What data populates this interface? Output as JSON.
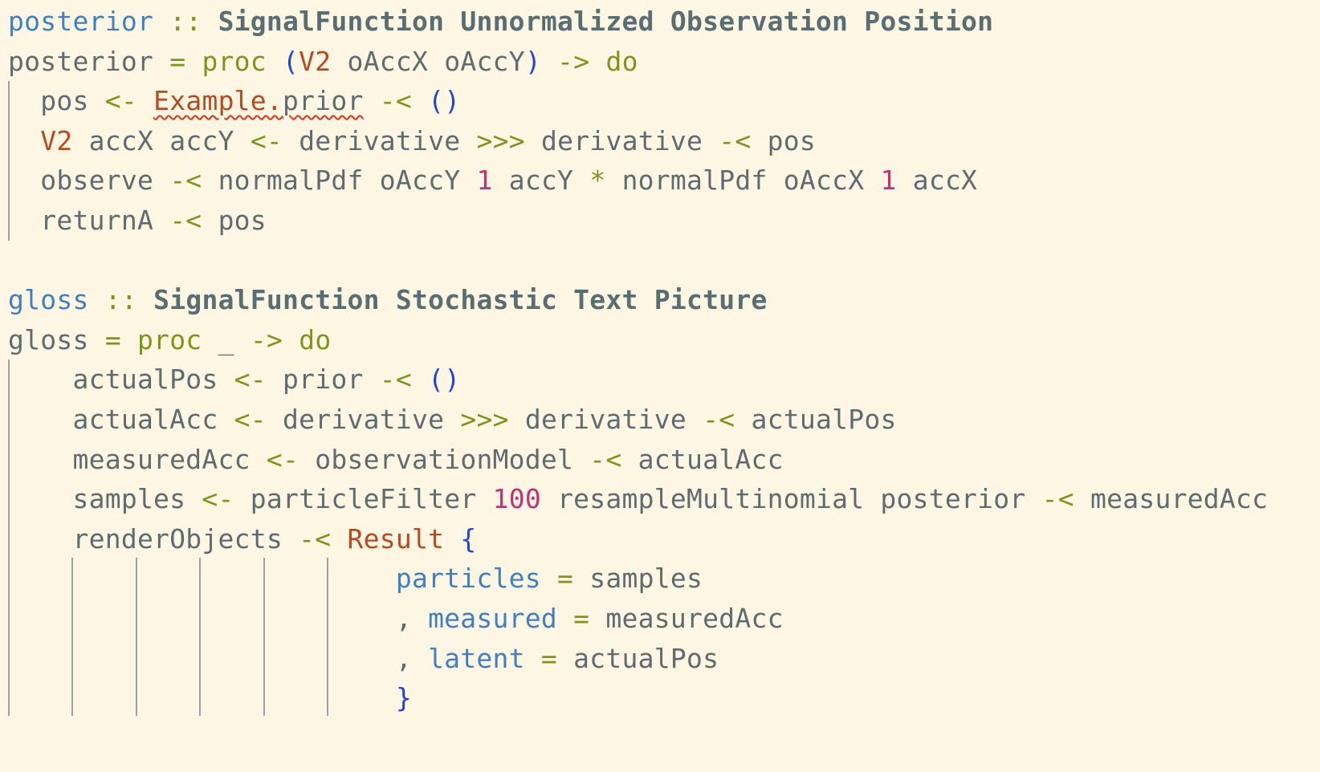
{
  "editor": {
    "language": "haskell",
    "theme": "solarized-light",
    "lines": [
      {
        "tokens": [
          {
            "t": "posterior",
            "c": "fn"
          },
          {
            "t": " "
          },
          {
            "t": "::",
            "c": "op"
          },
          {
            "t": " "
          },
          {
            "t": "SignalFunction Unnormalized Observation Position",
            "c": "ty"
          }
        ]
      },
      {
        "tokens": [
          {
            "t": "posterior",
            "c": "id"
          },
          {
            "t": " "
          },
          {
            "t": "=",
            "c": "op"
          },
          {
            "t": " "
          },
          {
            "t": "proc",
            "c": "kw"
          },
          {
            "t": " "
          },
          {
            "t": "(",
            "c": "par"
          },
          {
            "t": "V2",
            "c": "con"
          },
          {
            "t": " oAccX oAccY",
            "c": "id"
          },
          {
            "t": ")",
            "c": "par"
          },
          {
            "t": " "
          },
          {
            "t": "->",
            "c": "op"
          },
          {
            "t": " "
          },
          {
            "t": "do",
            "c": "kw"
          }
        ]
      },
      {
        "tokens": [
          {
            "t": "  pos",
            "c": "id"
          },
          {
            "t": " "
          },
          {
            "t": "<-",
            "c": "op"
          },
          {
            "t": " "
          },
          {
            "t": "Example.",
            "c": "con",
            "sq": true
          },
          {
            "t": "prior",
            "c": "id",
            "sq": true
          },
          {
            "t": " "
          },
          {
            "t": "-<",
            "c": "op"
          },
          {
            "t": " "
          },
          {
            "t": "()",
            "c": "par"
          }
        ]
      },
      {
        "tokens": [
          {
            "t": "  "
          },
          {
            "t": "V2",
            "c": "con"
          },
          {
            "t": " accX accY",
            "c": "id"
          },
          {
            "t": " "
          },
          {
            "t": "<-",
            "c": "op"
          },
          {
            "t": " "
          },
          {
            "t": "derivative",
            "c": "id"
          },
          {
            "t": " "
          },
          {
            "t": ">>>",
            "c": "op"
          },
          {
            "t": " "
          },
          {
            "t": "derivative",
            "c": "id"
          },
          {
            "t": " "
          },
          {
            "t": "-<",
            "c": "op"
          },
          {
            "t": " "
          },
          {
            "t": "pos",
            "c": "id"
          }
        ]
      },
      {
        "tokens": [
          {
            "t": "  observe",
            "c": "id"
          },
          {
            "t": " "
          },
          {
            "t": "-<",
            "c": "op"
          },
          {
            "t": " "
          },
          {
            "t": "normalPdf oAccY",
            "c": "id"
          },
          {
            "t": " "
          },
          {
            "t": "1",
            "c": "num"
          },
          {
            "t": " "
          },
          {
            "t": "accY",
            "c": "id"
          },
          {
            "t": " "
          },
          {
            "t": "*",
            "c": "op"
          },
          {
            "t": " "
          },
          {
            "t": "normalPdf oAccX",
            "c": "id"
          },
          {
            "t": " "
          },
          {
            "t": "1",
            "c": "num"
          },
          {
            "t": " "
          },
          {
            "t": "accX",
            "c": "id"
          }
        ]
      },
      {
        "tokens": [
          {
            "t": "  returnA",
            "c": "id"
          },
          {
            "t": " "
          },
          {
            "t": "-<",
            "c": "op"
          },
          {
            "t": " "
          },
          {
            "t": "pos",
            "c": "id"
          }
        ]
      },
      {
        "tokens": []
      },
      {
        "tokens": [
          {
            "t": "gloss",
            "c": "fn"
          },
          {
            "t": " "
          },
          {
            "t": "::",
            "c": "op"
          },
          {
            "t": " "
          },
          {
            "t": "SignalFunction Stochastic Text Picture",
            "c": "ty"
          }
        ]
      },
      {
        "tokens": [
          {
            "t": "gloss",
            "c": "id"
          },
          {
            "t": " "
          },
          {
            "t": "=",
            "c": "op"
          },
          {
            "t": " "
          },
          {
            "t": "proc",
            "c": "kw"
          },
          {
            "t": " "
          },
          {
            "t": "_",
            "c": "id"
          },
          {
            "t": " "
          },
          {
            "t": "->",
            "c": "op"
          },
          {
            "t": " "
          },
          {
            "t": "do",
            "c": "kw"
          }
        ]
      },
      {
        "tokens": [
          {
            "t": "    actualPos",
            "c": "id"
          },
          {
            "t": " "
          },
          {
            "t": "<-",
            "c": "op"
          },
          {
            "t": " "
          },
          {
            "t": "prior",
            "c": "id"
          },
          {
            "t": " "
          },
          {
            "t": "-<",
            "c": "op"
          },
          {
            "t": " "
          },
          {
            "t": "()",
            "c": "par"
          }
        ]
      },
      {
        "tokens": [
          {
            "t": "    actualAcc",
            "c": "id"
          },
          {
            "t": " "
          },
          {
            "t": "<-",
            "c": "op"
          },
          {
            "t": " "
          },
          {
            "t": "derivative",
            "c": "id"
          },
          {
            "t": " "
          },
          {
            "t": ">>>",
            "c": "op"
          },
          {
            "t": " "
          },
          {
            "t": "derivative",
            "c": "id"
          },
          {
            "t": " "
          },
          {
            "t": "-<",
            "c": "op"
          },
          {
            "t": " "
          },
          {
            "t": "actualPos",
            "c": "id"
          }
        ]
      },
      {
        "tokens": [
          {
            "t": "    measuredAcc",
            "c": "id"
          },
          {
            "t": " "
          },
          {
            "t": "<-",
            "c": "op"
          },
          {
            "t": " "
          },
          {
            "t": "observationModel",
            "c": "id"
          },
          {
            "t": " "
          },
          {
            "t": "-<",
            "c": "op"
          },
          {
            "t": " "
          },
          {
            "t": "actualAcc",
            "c": "id"
          }
        ]
      },
      {
        "tokens": [
          {
            "t": "    samples",
            "c": "id"
          },
          {
            "t": " "
          },
          {
            "t": "<-",
            "c": "op"
          },
          {
            "t": " "
          },
          {
            "t": "particleFilter",
            "c": "id"
          },
          {
            "t": " "
          },
          {
            "t": "100",
            "c": "num"
          },
          {
            "t": " "
          },
          {
            "t": "resampleMultinomial posterior",
            "c": "id"
          },
          {
            "t": " "
          },
          {
            "t": "-<",
            "c": "op"
          },
          {
            "t": " "
          },
          {
            "t": "measuredAcc",
            "c": "id"
          }
        ]
      },
      {
        "tokens": [
          {
            "t": "    renderObjects",
            "c": "id"
          },
          {
            "t": " "
          },
          {
            "t": "-<",
            "c": "op"
          },
          {
            "t": " "
          },
          {
            "t": "Result",
            "c": "con"
          },
          {
            "t": " "
          },
          {
            "t": "{",
            "c": "par"
          }
        ]
      },
      {
        "tokens": [
          {
            "t": "                        "
          },
          {
            "t": "particles",
            "c": "fld"
          },
          {
            "t": " "
          },
          {
            "t": "=",
            "c": "op"
          },
          {
            "t": " "
          },
          {
            "t": "samples",
            "c": "id"
          }
        ]
      },
      {
        "tokens": [
          {
            "t": "                        , ",
            "c": "id"
          },
          {
            "t": "measured",
            "c": "fld"
          },
          {
            "t": " "
          },
          {
            "t": "=",
            "c": "op"
          },
          {
            "t": " "
          },
          {
            "t": "measuredAcc",
            "c": "id"
          }
        ]
      },
      {
        "tokens": [
          {
            "t": "                        , ",
            "c": "id"
          },
          {
            "t": "latent",
            "c": "fld"
          },
          {
            "t": " "
          },
          {
            "t": "=",
            "c": "op"
          },
          {
            "t": " "
          },
          {
            "t": "actualPos",
            "c": "id"
          }
        ]
      },
      {
        "tokens": [
          {
            "t": "                        "
          },
          {
            "t": "}",
            "c": "par"
          }
        ]
      }
    ]
  }
}
